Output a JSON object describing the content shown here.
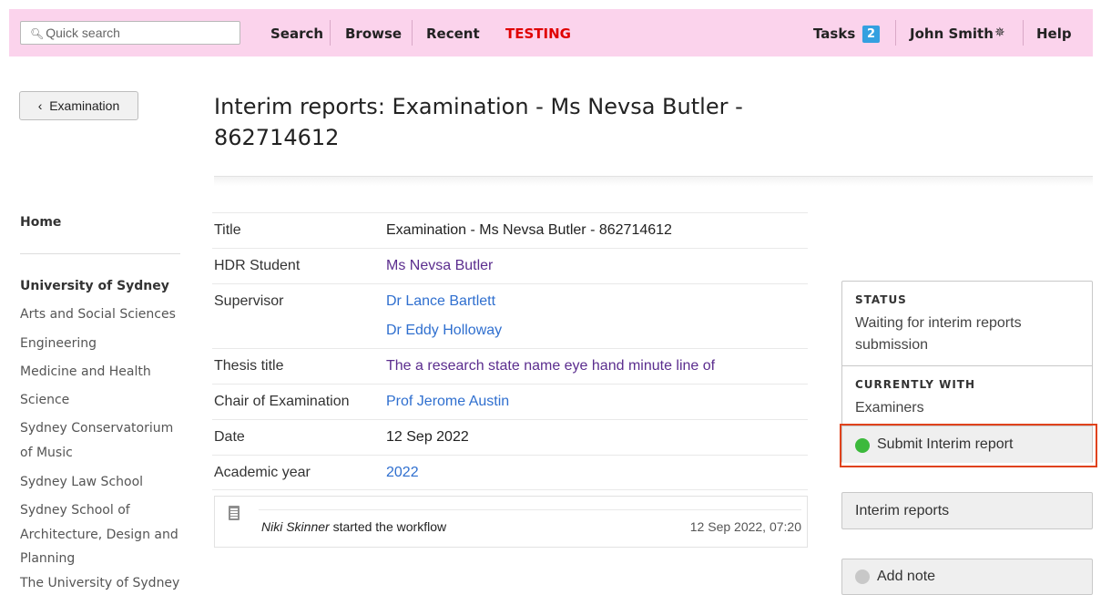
{
  "header": {
    "search_placeholder": "Quick search",
    "nav": [
      "Search",
      "Browse",
      "Recent",
      "TESTING"
    ],
    "tasks_label": "Tasks",
    "tasks_count": "2",
    "user_name": "John Smith",
    "help_label": "Help",
    "testing_color": "#e00000"
  },
  "back_button": "Examination",
  "page_title_line1": "Interim reports: Examination - Ms Nevsa Butler -",
  "page_title_line2": "862714612",
  "sidebar": {
    "home": "Home",
    "heading": "University of Sydney",
    "items": [
      "Arts and Social Sciences",
      "Engineering",
      "Medicine and Health",
      "Science",
      "Sydney Conservatorium",
      "of Music",
      "Sydney Law School",
      "Sydney School of",
      "Architecture, Design and",
      "Planning",
      "The University of Sydney"
    ]
  },
  "details": {
    "title_label": "Title",
    "title_value": "Examination - Ms Nevsa Butler - 862714612",
    "student_label": "HDR Student",
    "student_value": "Ms Nevsa Butler",
    "supervisor_label": "Supervisor",
    "supervisors": [
      "Dr Lance Bartlett",
      "Dr Eddy Holloway"
    ],
    "thesis_label": "Thesis title",
    "thesis_value": "The a research state name eye hand minute line of",
    "chair_label": "Chair of Examination",
    "chair_value": "Prof Jerome Austin",
    "date_label": "Date",
    "date_value": "12 Sep 2022",
    "year_label": "Academic year",
    "year_value": "2022"
  },
  "activity": {
    "actor": "Niki Skinner",
    "action": " started the workflow",
    "time": "12 Sep 2022, 07:20"
  },
  "status": {
    "status_heading": "STATUS",
    "status_text": "Waiting for interim reports submission",
    "with_heading": "CURRENTLY WITH",
    "with_text": "Examiners",
    "submit_label": "Submit Interim report",
    "submit_dot_color": "#3cb93c"
  },
  "actions": {
    "interim_reports": "Interim reports",
    "add_note": "Add note",
    "note_dot_color": "#c8c8c8"
  }
}
